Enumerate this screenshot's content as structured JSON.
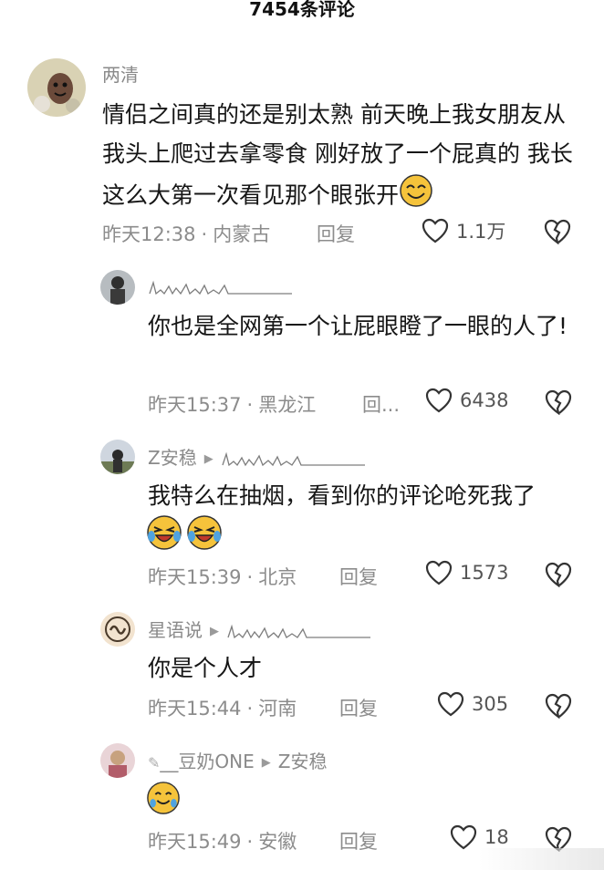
{
  "header": {
    "title": "7454条评论"
  },
  "comments": [
    {
      "name": "两清",
      "text": "情侣之间真的还是别太熟  前天晚上我女朋友从我头上爬过去拿零食  刚好放了一个屁真的  我长这么大第一次看见那个眼张开",
      "time": "昨天12:38",
      "location": "内蒙古",
      "reply": "回复",
      "likes": "1.1万"
    },
    {
      "name": "",
      "text": "你也是全网第一个让屁眼瞪了一眼的人了!",
      "time": "昨天15:37",
      "location": "黑龙江",
      "reply": "回...",
      "likes": "6438"
    },
    {
      "name": "Z安稳",
      "text": "我特么在抽烟，看到你的评论呛死我了",
      "time": "昨天15:39",
      "location": "北京",
      "reply": "回复",
      "likes": "1573"
    },
    {
      "name": "星语说",
      "text": "你是个人才",
      "time": "昨天15:44",
      "location": "河南",
      "reply": "回复",
      "likes": "305"
    },
    {
      "name": "__豆奶ONE",
      "reply_to": "Z安稳",
      "text": "",
      "time": "昨天15:49",
      "location": "安徽",
      "reply": "回复",
      "likes": "18"
    }
  ],
  "colors": {
    "text": "#161616",
    "meta": "#8c8c8c",
    "accent": "#f5c33b"
  }
}
